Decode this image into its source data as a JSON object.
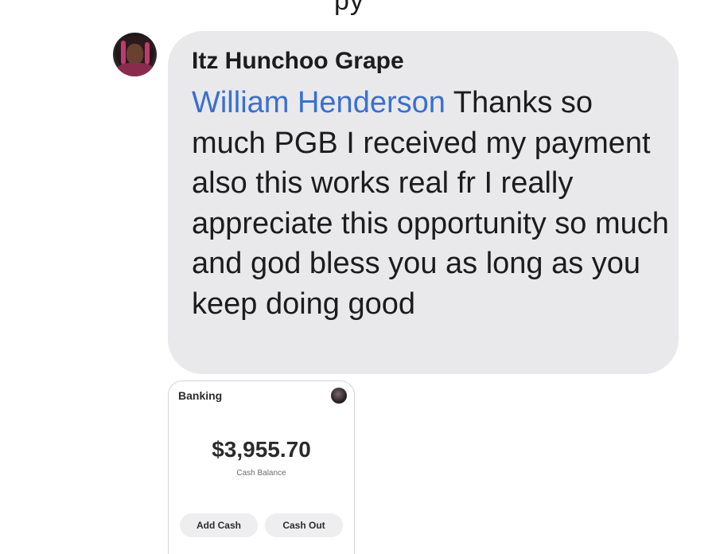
{
  "header": {
    "cut_text": "py"
  },
  "message": {
    "sender": "Itz Hunchoo Grape",
    "mention": "William Henderson",
    "text": "Thanks so much PGB I received my payment also this works real fr I really appreciate this opportunity so much and god bless you as long as you keep doing good"
  },
  "attachment": {
    "title": "Banking",
    "balance": "$3,955.70",
    "balance_caption": "Cash Balance",
    "add_cash_label": "Add Cash",
    "cash_out_label": "Cash Out"
  },
  "colors": {
    "bubble": "#e9e9eb",
    "mention": "#3a6fcf",
    "text": "#1c1c1e"
  }
}
